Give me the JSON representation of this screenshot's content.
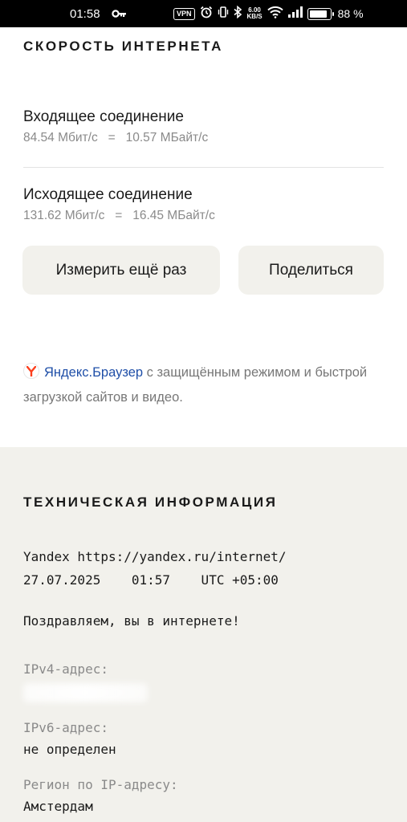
{
  "status_bar": {
    "time": "01:58",
    "vpn_label": "VPN",
    "net_speed_value": "6.00",
    "net_speed_unit": "KB/S",
    "battery_percent": "88 %",
    "battery_level": 0.88
  },
  "speed": {
    "title": "СКОРОСТЬ ИНТЕРНЕТА",
    "download": {
      "title": "Входящее соединение",
      "value": "84.54 Мбит/с   =   10.57 МБайт/с"
    },
    "upload": {
      "title": "Исходящее соединение",
      "value": "131.62 Мбит/с   =   16.45 МБайт/с"
    },
    "retest_button": "Измерить ещё раз",
    "share_button": "Поделиться"
  },
  "promo": {
    "link_text": "Яндекс.Браузер",
    "text": " с защищённым режимом и быстрой загрузкой сайтов и видео."
  },
  "tech_info": {
    "title": "ТЕХНИЧЕСКАЯ ИНФОРМАЦИЯ",
    "line1": "Yandex https://yandex.ru/internet/",
    "line2": "27.07.2025    01:57    UTC +05:00",
    "greeting": "Поздравляем, вы в интернете!",
    "ipv4_label": "IPv4-адрес:",
    "ipv6_label": "IPv6-адрес:",
    "ipv6_value": "не определен",
    "region_label": "Регион по IP-адресу:",
    "region_value": "Амстердам"
  },
  "colors": {
    "link": "#1f4fa8",
    "button_bg": "#f2f1ec",
    "tech_bg": "#f2f1ec",
    "yandex_red": "#fc3f1d"
  }
}
